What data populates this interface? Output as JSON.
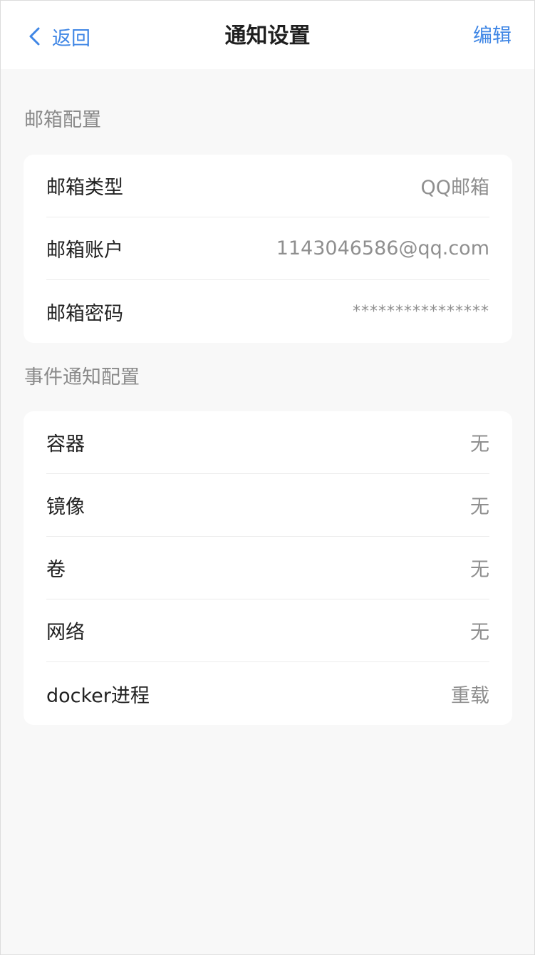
{
  "header": {
    "back_label": "返回",
    "title": "通知设置",
    "edit_label": "编辑"
  },
  "mail_section": {
    "title": "邮箱配置",
    "items": [
      {
        "label": "邮箱类型",
        "value": "QQ邮箱"
      },
      {
        "label": "邮箱账户",
        "value": "1143046586@qq.com"
      },
      {
        "label": "邮箱密码",
        "value": "****************"
      }
    ]
  },
  "event_section": {
    "title": "事件通知配置",
    "items": [
      {
        "label": "容器",
        "value": "无"
      },
      {
        "label": "镜像",
        "value": "无"
      },
      {
        "label": "卷",
        "value": "无"
      },
      {
        "label": "网络",
        "value": "无"
      },
      {
        "label": "docker进程",
        "value": "重载"
      }
    ]
  },
  "colors": {
    "accent": "#3f86e5",
    "background": "#f8f8f8",
    "card": "#ffffff",
    "muted_text": "#8f8f8f"
  }
}
